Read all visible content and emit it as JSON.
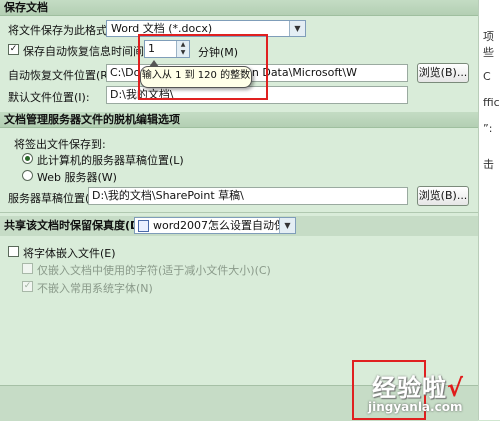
{
  "save_section": {
    "header": "保存文档",
    "format_label": "将文件保存为此格式(F):",
    "format_value": "Word 文档 (*.docx)",
    "autorecover_label": "保存自动恢复信息时间间隔(A)",
    "autorecover_checked": true,
    "interval_value": "1",
    "minutes_label": "分钟(M)",
    "tooltip": "输入从 1 到 120 的整数",
    "autorecover_location_label": "自动恢复文件位置(R):",
    "autorecover_location_value": "C:\\Docu          strator\\Application Data\\Microsoft\\W",
    "browse_label": "浏览(B)...",
    "default_location_label": "默认文件位置(I):",
    "default_location_value": "D:\\我的文档\\"
  },
  "server_section": {
    "header": "文档管理服务器文件的脱机编辑选项",
    "checkout_label": "将签出文件保存到:",
    "option_server_drafts": "此计算机的服务器草稿位置(L)",
    "option_web_server": "Web 服务器(W)",
    "selected_option": "server_drafts",
    "drafts_location_label": "服务器草稿位置(V):",
    "drafts_location_value": "D:\\我的文档\\SharePoint 草稿\\",
    "browse_label": "浏览(B)..."
  },
  "fidelity_section": {
    "header_label": "共享该文档时保留保真度(D):",
    "document_value": "word2007怎么设置自动保存时间",
    "embed_fonts_label": "将字体嵌入文件(E)",
    "embed_fonts_checked": false,
    "embed_used_chars_label": "仅嵌入文档中使用的字符(适于减小文件大小)(C)",
    "no_common_fonts_label": "不嵌入常用系统字体(N)",
    "no_common_fonts_checked": true
  },
  "side_text": {
    "t1": "项",
    "t2": "些",
    "t3": "C",
    "t4": "ffic",
    "t5": "”:",
    "t6": "击"
  },
  "watermark": {
    "text": "经验啦",
    "check": "√",
    "url": "jingyanla.com"
  },
  "colors": {
    "dialog_bg": "#d9ecd9",
    "header_bg": "#b3cfb3",
    "highlight": "#e02020",
    "tooltip_bg": "#ffffe8"
  }
}
